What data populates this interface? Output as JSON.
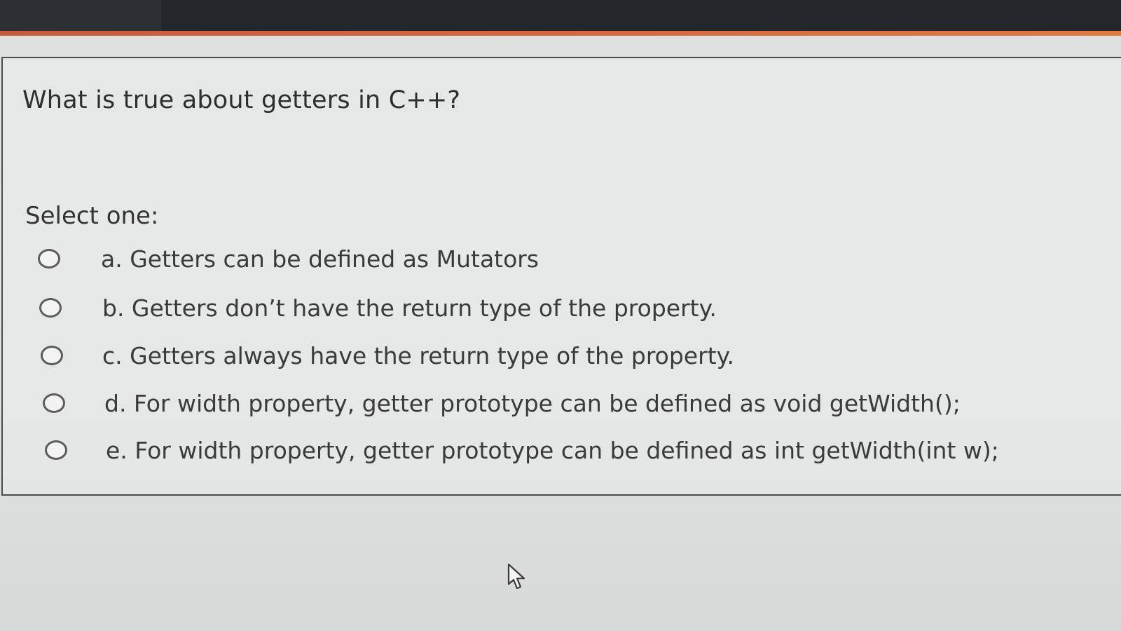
{
  "question": {
    "text": "What is true about getters in C++?",
    "prompt": "Select one:",
    "options": [
      {
        "label": "a. Getters can be defined as Mutators"
      },
      {
        "label": "b. Getters don’t have the return type of the property."
      },
      {
        "label": "c. Getters always have the return type of the property."
      },
      {
        "label": "d. For width property, getter prototype can be defined as void getWidth();"
      },
      {
        "label": "e. For width property, getter prototype can be defined as int getWidth(int w);"
      }
    ]
  },
  "colors": {
    "accent": "#d5663f",
    "top_bar": "#23262a",
    "text": "#2e2e2e"
  },
  "icons": {
    "pointer": "mouse-pointer-icon"
  }
}
